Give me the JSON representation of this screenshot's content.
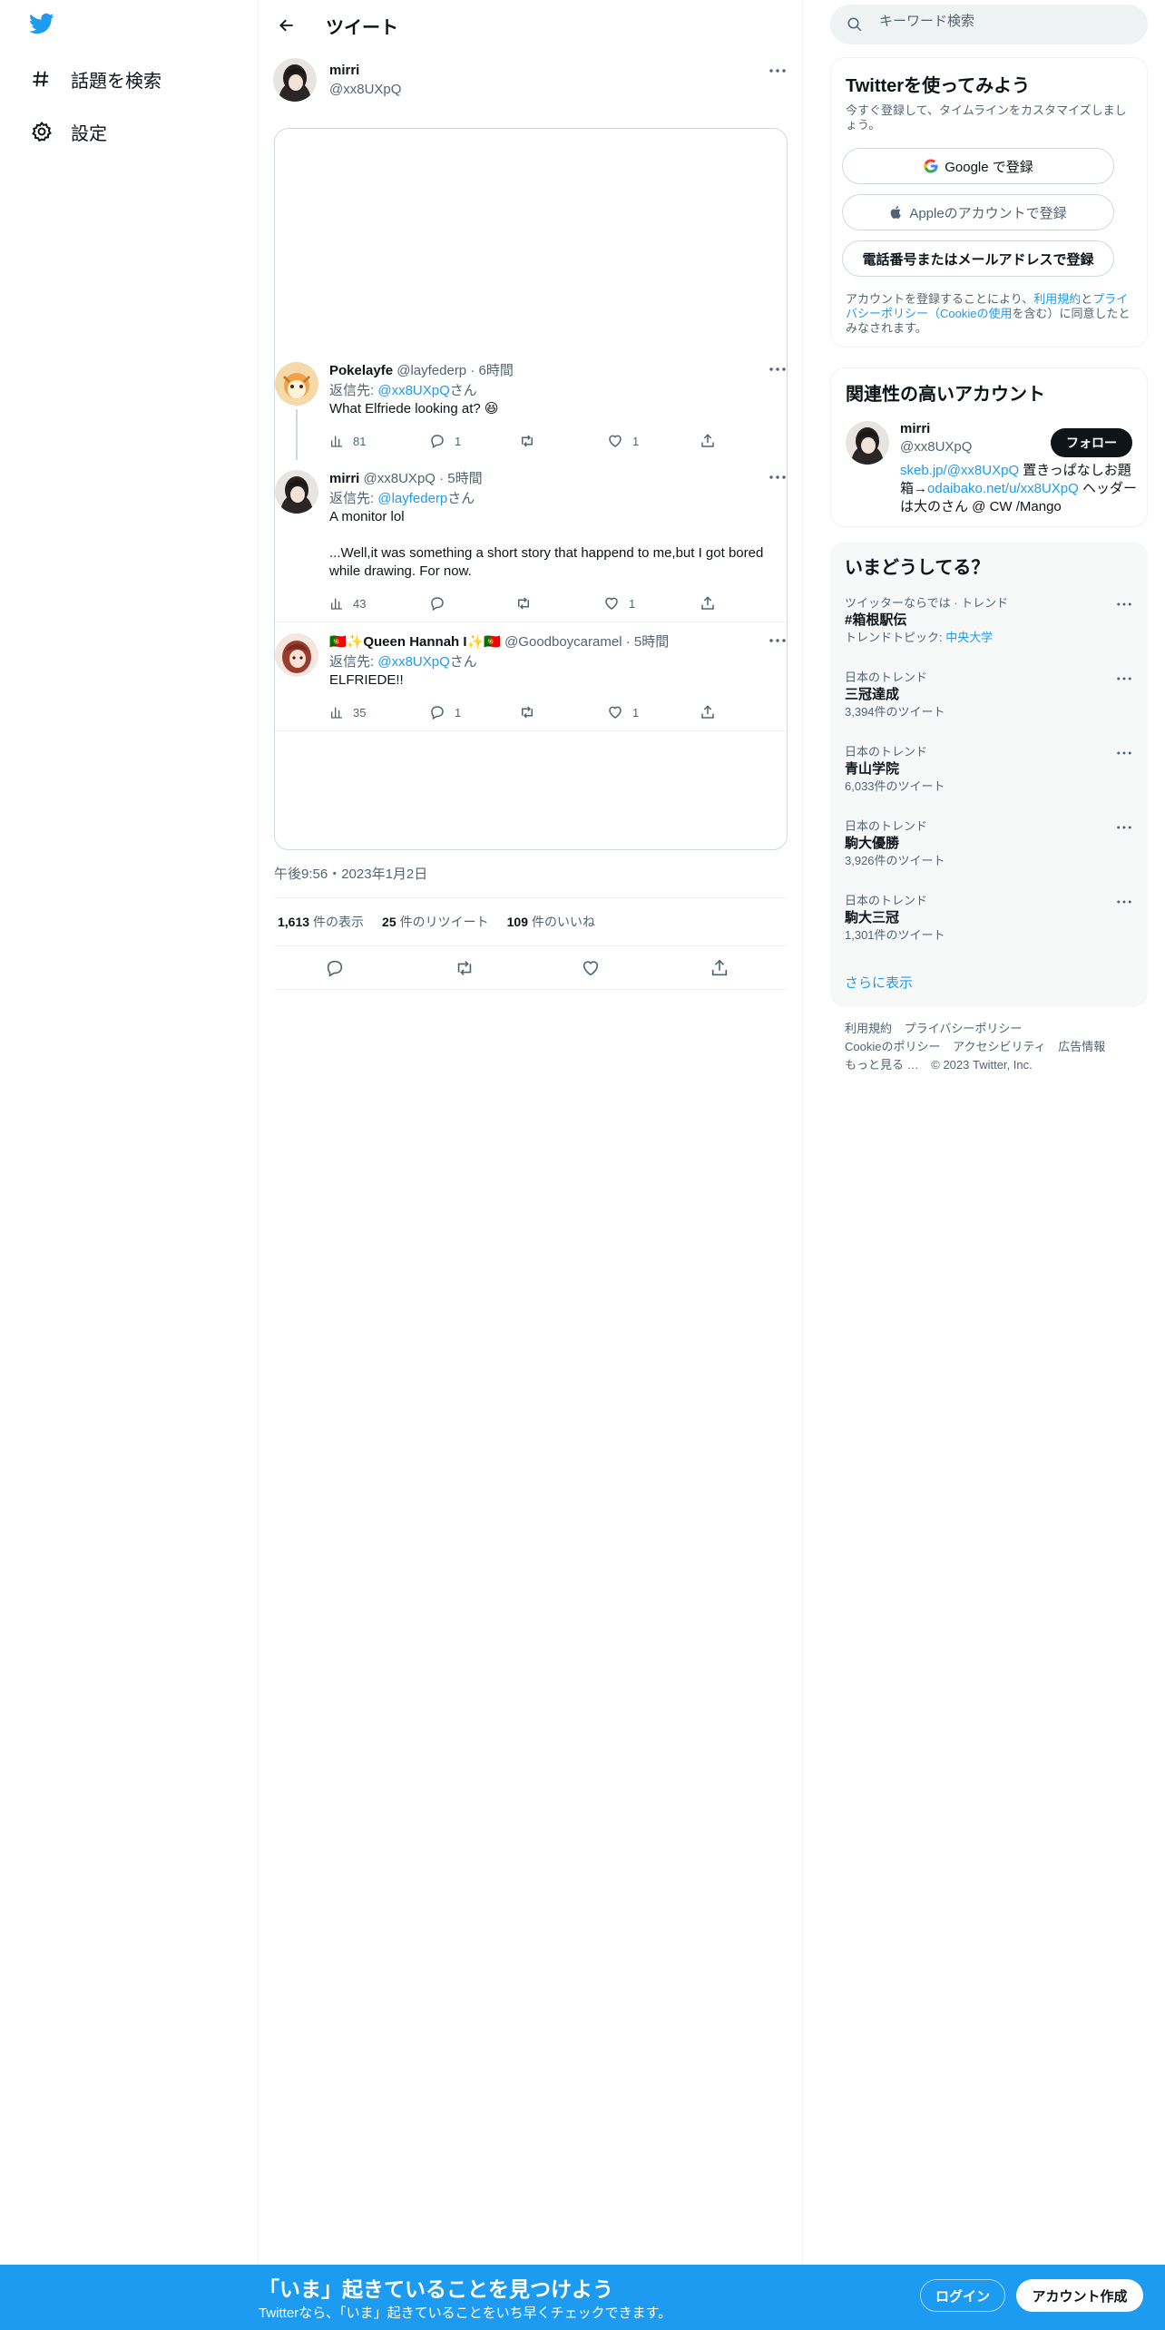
{
  "colors": {
    "accent": "#1d9bf0",
    "text": "#0f1419",
    "muted": "#536471"
  },
  "nav": {
    "items": [
      {
        "label": "話題を検索",
        "icon": "hashtag-icon"
      },
      {
        "label": "設定",
        "icon": "gear-icon"
      }
    ]
  },
  "header": {
    "title": "ツイート"
  },
  "tweet": {
    "author_name": "mirri",
    "author_handle": "@xx8UXpQ",
    "timestamp": "午後9:56・2023年1月2日",
    "stats": {
      "views_count": "1,613",
      "views_label": "件の表示",
      "retweets_count": "25",
      "retweets_label": "件のリツイート",
      "likes_count": "109",
      "likes_label": "件のいいね"
    }
  },
  "replies": [
    {
      "name": "Pokelayfe",
      "handle": "@layfederp",
      "time": "6時間",
      "replying_prefix": "返信先: ",
      "replying_to": "@xx8UXpQ",
      "replying_suffix": "さん",
      "text": "What Elfriede looking at? 😆",
      "views": "81",
      "replies": "1",
      "retweets": "",
      "likes": "1"
    },
    {
      "name": "mirri",
      "handle": "@xx8UXpQ",
      "time": "5時間",
      "replying_prefix": "返信先: ",
      "replying_to": "@layfederp",
      "replying_suffix": "さん",
      "text_line1": "A monitor lol",
      "text_line2": "...Well,it was something a short story that happend to me,but I got bored while drawing. For now.",
      "views": "43",
      "replies": "",
      "retweets": "",
      "likes": "1"
    },
    {
      "name": "🇵🇹✨Queen Hannah I✨🇵🇹",
      "handle": "@Goodboycaramel",
      "time": "5時間",
      "replying_prefix": "返信先: ",
      "replying_to": "@xx8UXpQ",
      "replying_suffix": "さん",
      "text": "ELFRIEDE!!",
      "views": "35",
      "replies": "1",
      "retweets": "",
      "likes": "1"
    }
  ],
  "search": {
    "placeholder": "キーワード検索"
  },
  "signup_card": {
    "title": "Twitterを使ってみよう",
    "subtitle": "今すぐ登録して、タイムラインをカスタマイズしましょう。",
    "google_label": "Google で登録",
    "apple_label": "Appleのアカウントで登録",
    "phone_label": "電話番号またはメールアドレスで登録",
    "legal_prefix": "アカウントを登録することにより、",
    "legal_terms": "利用規約",
    "legal_and": "と",
    "legal_privacy": "プライバシーポリシー（Cookieの使用",
    "legal_suffix": "を含む）に同意したとみなされます。"
  },
  "related": {
    "title": "関連性の高いアカウント",
    "name": "mirri",
    "handle": "@xx8UXpQ",
    "follow_label": "フォロー",
    "bio_link1": "skeb.jp/@xx8UXpQ",
    "bio_text1": " 置きっぱなしお題箱→",
    "bio_link2": "odaibako.net/u/xx8UXpQ",
    "bio_text2": " ヘッダーは大のさん @ CW /Mango"
  },
  "trends": {
    "title": "いまどうしてる？",
    "items": [
      {
        "context": "ツイッターならでは · トレンド",
        "title": "#箱根駅伝",
        "count_prefix": "トレンドトピック: ",
        "count_link": "中央大学",
        "count": ""
      },
      {
        "context": "日本のトレンド",
        "title": "三冠達成",
        "count": "3,394件のツイート"
      },
      {
        "context": "日本のトレンド",
        "title": "青山学院",
        "count": "6,033件のツイート"
      },
      {
        "context": "日本のトレンド",
        "title": "駒大優勝",
        "count": "3,926件のツイート"
      },
      {
        "context": "日本のトレンド",
        "title": "駒大三冠",
        "count": "1,301件のツイート"
      }
    ],
    "show_more": "さらに表示"
  },
  "footer": {
    "terms": "利用規約",
    "privacy": "プライバシーポリシー",
    "cookie": "Cookieのポリシー",
    "accessibility": "アクセシビリティ",
    "ads": "広告情報",
    "more": "もっと見る …",
    "copyright": "© 2023 Twitter, Inc."
  },
  "banner": {
    "title": "「いま」起きていることを見つけよう",
    "subtitle": "Twitterなら、「いま」起きていることをいち早くチェックできます。",
    "login_label": "ログイン",
    "signup_label": "アカウント作成"
  }
}
